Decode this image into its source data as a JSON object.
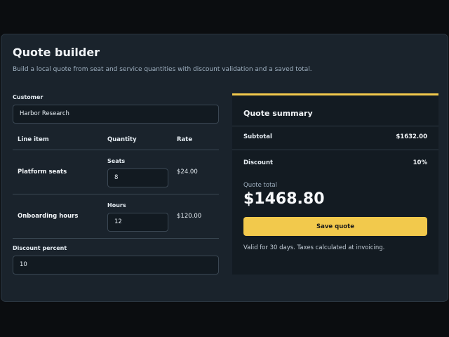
{
  "header": {
    "title": "Quote builder",
    "subtitle": "Build a local quote from seat and service quantities with discount validation and a saved total."
  },
  "customer": {
    "label": "Customer",
    "value": "Harbor Research"
  },
  "table": {
    "headers": [
      "Line item",
      "Quantity",
      "Rate"
    ],
    "rows": [
      {
        "name": "Platform seats",
        "qty_label": "Seats",
        "qty": "8",
        "rate": "$24.00"
      },
      {
        "name": "Onboarding hours",
        "qty_label": "Hours",
        "qty": "12",
        "rate": "$120.00"
      }
    ]
  },
  "discount": {
    "label": "Discount percent",
    "value": "10"
  },
  "summary": {
    "title": "Quote summary",
    "subtotal_label": "Subtotal",
    "subtotal_value": "$1632.00",
    "discount_label": "Discount",
    "discount_value": "10%",
    "total_label": "Quote total",
    "total_value": "$1468.80",
    "save_label": "Save quote",
    "note": "Valid for 30 days. Taxes calculated at invoicing."
  },
  "colors": {
    "accent": "#f2c94c",
    "card": "#1a232c",
    "panel": "#131b22"
  }
}
